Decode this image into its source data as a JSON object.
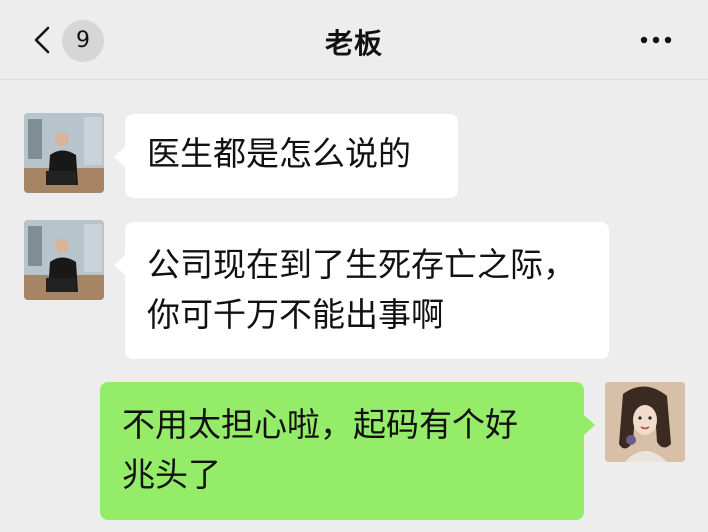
{
  "header": {
    "unread_count": "9",
    "title": "老板",
    "back_icon": "chevron-left-icon",
    "more_icon": "more-dots-icon"
  },
  "messages": [
    {
      "sender": "boss",
      "direction": "incoming",
      "lines": [
        "医生都是怎么说的"
      ]
    },
    {
      "sender": "boss",
      "direction": "incoming",
      "lines": [
        "公司现在到了生死存亡之际，",
        "你可千万不能出事啊"
      ]
    },
    {
      "sender": "me",
      "direction": "outgoing",
      "lines": [
        "不用太担心啦，起码有个好",
        "兆头了"
      ]
    }
  ],
  "colors": {
    "background": "#ededed",
    "incoming_bubble": "#ffffff",
    "outgoing_bubble": "#95ec69",
    "badge": "#d6d6d6"
  }
}
